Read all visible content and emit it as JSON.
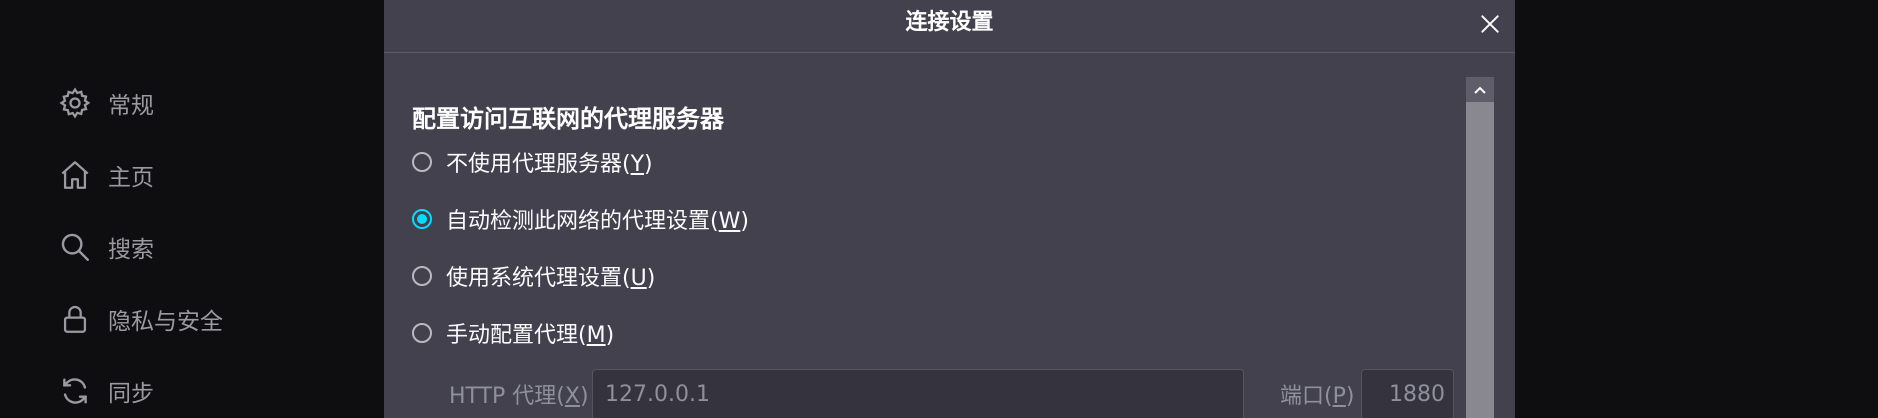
{
  "sidebar": {
    "items": [
      {
        "label": "常规",
        "icon": "gear-icon"
      },
      {
        "label": "主页",
        "icon": "home-icon"
      },
      {
        "label": "搜索",
        "icon": "search-icon"
      },
      {
        "label": "隐私与安全",
        "icon": "lock-icon"
      },
      {
        "label": "同步",
        "icon": "sync-icon"
      }
    ]
  },
  "dialog": {
    "title": "连接设置",
    "heading": "配置访问互联网的代理服务器",
    "options": [
      {
        "text": "不使用代理服务器(",
        "key": "Y",
        "close": ")",
        "checked": false
      },
      {
        "text": "自动检测此网络的代理设置(",
        "key": "W",
        "close": ")",
        "checked": true
      },
      {
        "text": "使用系统代理设置(",
        "key": "U",
        "close": ")",
        "checked": false
      },
      {
        "text": "手动配置代理(",
        "key": "M",
        "close": ")",
        "checked": false
      }
    ],
    "http_proxy": {
      "label_prefix": "HTTP 代理(",
      "label_key": "X",
      "label_suffix": ")",
      "value": "127.0.0.1"
    },
    "port": {
      "label_prefix": "端口(",
      "label_key": "P",
      "label_suffix": ")",
      "value": "1880"
    }
  },
  "colors": {
    "accent": "#00ddff",
    "dialog_bg": "#42414d",
    "page_bg": "#0e0e11"
  }
}
